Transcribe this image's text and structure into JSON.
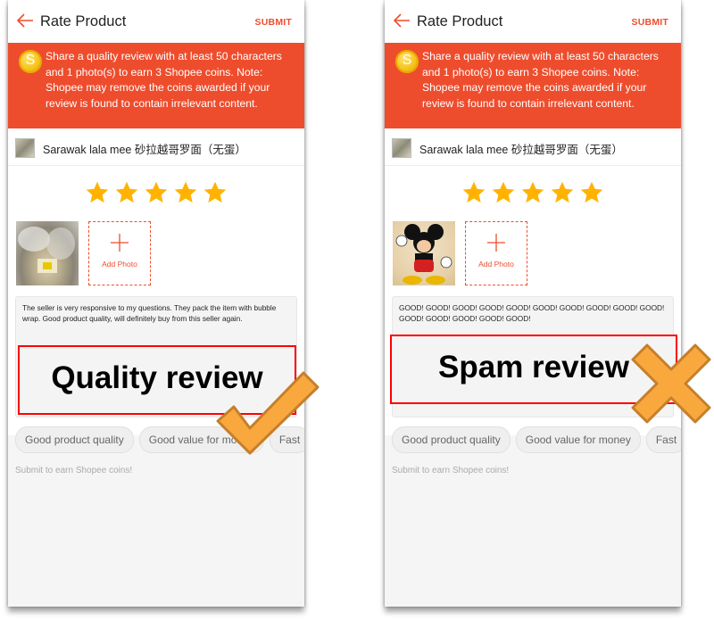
{
  "screens": [
    {
      "header": {
        "title": "Rate Product",
        "submit_label": "SUBMIT"
      },
      "banner": {
        "coin_letter": "S",
        "text": "Share a quality review with at least 50 characters and 1 photo(s) to earn 3 Shopee coins. Note: Shopee may remove the coins awarded if your review is found to contain irrelevant content."
      },
      "product": {
        "name": "Sarawak lala mee 砂拉越哥罗面（无蛋）"
      },
      "rating": {
        "stars": 5,
        "max": 5
      },
      "photo": {
        "subject": "packaged noodles in bubble wrap"
      },
      "add_photo_label": "Add Photo",
      "review_text": "The seller is very responsive to my questions. They pack the item with bubble wrap. Good product quality, will definitely buy from this seller again.",
      "tags": [
        "Good product quality",
        "Good value for money",
        "Fast"
      ],
      "hint": "Submit to earn Shopee coins!",
      "annotation": {
        "label": "Quality review",
        "mark": "checkmark-icon"
      }
    },
    {
      "header": {
        "title": "Rate Product",
        "submit_label": "SUBMIT"
      },
      "banner": {
        "coin_letter": "S",
        "text": "Share a quality review with at least 50 characters and 1 photo(s) to earn 3 Shopee coins. Note: Shopee may remove the coins awarded if your review is found to contain irrelevant content."
      },
      "product": {
        "name": "Sarawak lala mee 砂拉越哥罗面（无蛋）"
      },
      "rating": {
        "stars": 5,
        "max": 5
      },
      "photo": {
        "subject": "Mickey Mouse cartoon"
      },
      "add_photo_label": "Add Photo",
      "review_text": "GOOD! GOOD! GOOD! GOOD! GOOD! GOOD! GOOD! GOOD! GOOD! GOOD! GOOD! GOOD! GOOD! GOOD! GOOD!",
      "tags": [
        "Good product quality",
        "Good value for money",
        "Fast"
      ],
      "hint": "Submit to earn Shopee coins!",
      "annotation": {
        "label": "Spam review",
        "mark": "cross-icon"
      }
    }
  ],
  "colors": {
    "brand": "#ee4d2d",
    "star": "#ffb300",
    "annotation_border": "#ff0000",
    "mark_fill": "#f9a83e",
    "mark_stroke": "#c57f2a"
  }
}
